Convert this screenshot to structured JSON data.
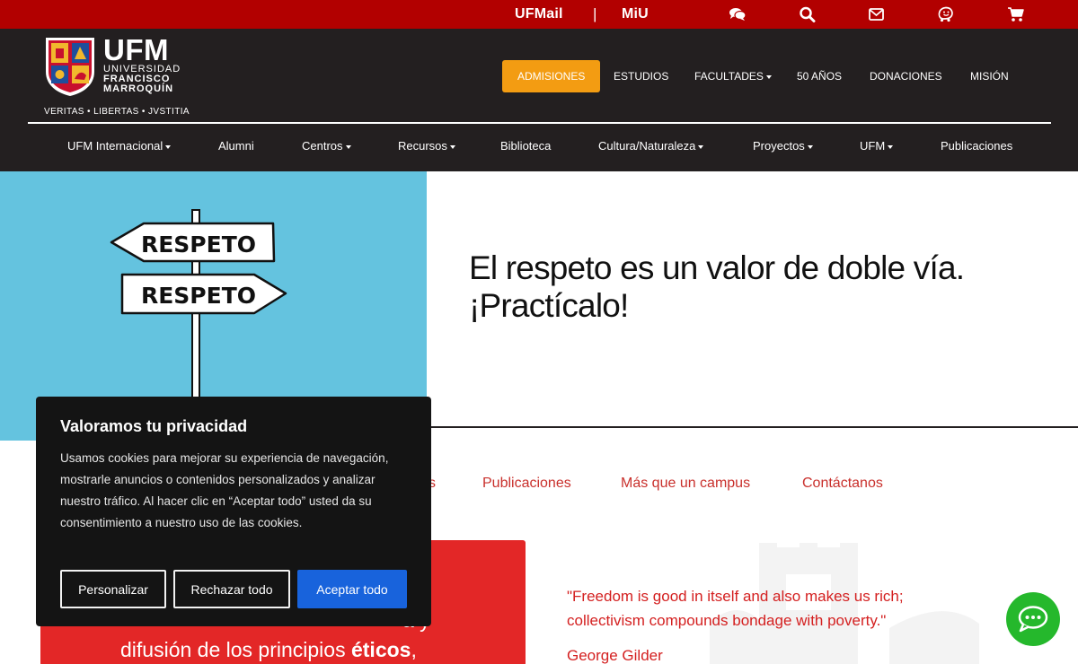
{
  "topbar": {
    "links": [
      "UFMail",
      "MiU"
    ],
    "separator": "|",
    "icons": [
      "comments-icon",
      "search-icon",
      "envelope-icon",
      "waze-icon",
      "shopping-cart-icon"
    ]
  },
  "logo": {
    "big": "UFM",
    "line1": "UNIVERSIDAD",
    "line2": "FRANCISCO",
    "line3": "MARROQUÍN",
    "motto": "VERITAS • LIBERTAS • JVSTITIA"
  },
  "main_nav": [
    {
      "label": "Admisiones"
    },
    {
      "label": "Estudios"
    },
    {
      "label": "Facultades"
    },
    {
      "label": "50 años"
    },
    {
      "label": "Donaciones"
    },
    {
      "label": "Misión"
    }
  ],
  "sub_nav": [
    {
      "label": "UFM Internacional"
    },
    {
      "label": "Alumni"
    },
    {
      "label": "Centros"
    },
    {
      "label": "Recursos"
    },
    {
      "label": "Biblioteca"
    },
    {
      "label": "Cultura/Naturaleza"
    },
    {
      "label": "Proyectos"
    },
    {
      "label": "UFM"
    },
    {
      "label": "Publicaciones"
    }
  ],
  "hero": {
    "sign_top": "RESPETO",
    "sign_bottom": "RESPETO",
    "title_line1": "El respeto es un valor de doble vía.",
    "title_line2": "¡Practícalo!"
  },
  "section_links": [
    "s",
    "Publicaciones",
    "Más que un campus",
    "Contáctanos"
  ],
  "red_block": {
    "line1_end": "a y",
    "line2_prefix": "difusión de los principios ",
    "line2_bold": "éticos",
    "line2_suffix": ","
  },
  "quote": {
    "text": "\"Freedom is good in itself and also makes us rich; collectivism compounds bondage with poverty.\"",
    "author": "George Gilder"
  },
  "cookie": {
    "title": "Valoramos tu privacidad",
    "body": "Usamos cookies para mejorar su experiencia de navegación, mostrarle anuncios o contenidos personalizados y analizar nuestro tráfico. Al hacer clic en “Aceptar todo” usted da su consentimiento a nuestro uso de las cookies.",
    "btn_customize": "Personalizar",
    "btn_reject": "Rechazar todo",
    "btn_accept": "Aceptar todo"
  },
  "colors": {
    "topbar": "#b20000",
    "header": "#231f20",
    "admisiones": "#f39c12",
    "hero_bg": "#64c3df",
    "accent_red": "#e32727",
    "accept_blue": "#1863dc",
    "chat_green": "#25b82c"
  }
}
